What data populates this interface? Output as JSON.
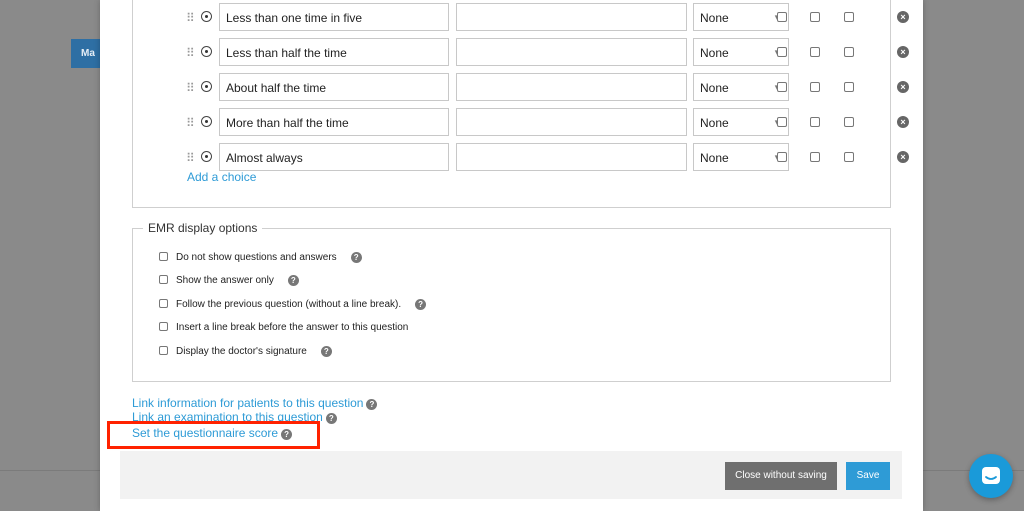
{
  "background": {
    "tab_label": "Ma"
  },
  "choices": [
    {
      "label": "Less than one time in five",
      "extra": "",
      "select": "None"
    },
    {
      "label": "Less than half the time",
      "extra": "",
      "select": "None"
    },
    {
      "label": "About half the time",
      "extra": "",
      "select": "None"
    },
    {
      "label": "More than half the time",
      "extra": "",
      "select": "None"
    },
    {
      "label": "Almost always",
      "extra": "",
      "select": "None"
    }
  ],
  "add_choice_label": "Add a choice",
  "emr": {
    "legend": "EMR display options",
    "options": [
      {
        "label": "Do not show questions and answers",
        "help": true
      },
      {
        "label": "Show the answer only",
        "help": true
      },
      {
        "label": "Follow the previous question (without a line break).",
        "help": true
      },
      {
        "label": "Insert a line break before the answer to this question",
        "help": false
      },
      {
        "label": "Display the doctor's signature",
        "help": true
      }
    ]
  },
  "links": {
    "patient_info": "Link information for patients to this question",
    "examination": "Link an examination to this question",
    "score": "Set the questionnaire score"
  },
  "footer": {
    "close_label": "Close without saving",
    "save_label": "Save"
  },
  "icons": {
    "drag": "drag-handle-icon",
    "radio": "radio-icon",
    "remove": "remove-circle-icon",
    "help": "question-circle-icon",
    "chat": "chat-bubble-icon"
  },
  "colors": {
    "link": "#2e9bd6",
    "save": "#2e9bd6",
    "close": "#6f6f6f",
    "highlight": "#ff2200",
    "chat": "#1a9ad9"
  }
}
